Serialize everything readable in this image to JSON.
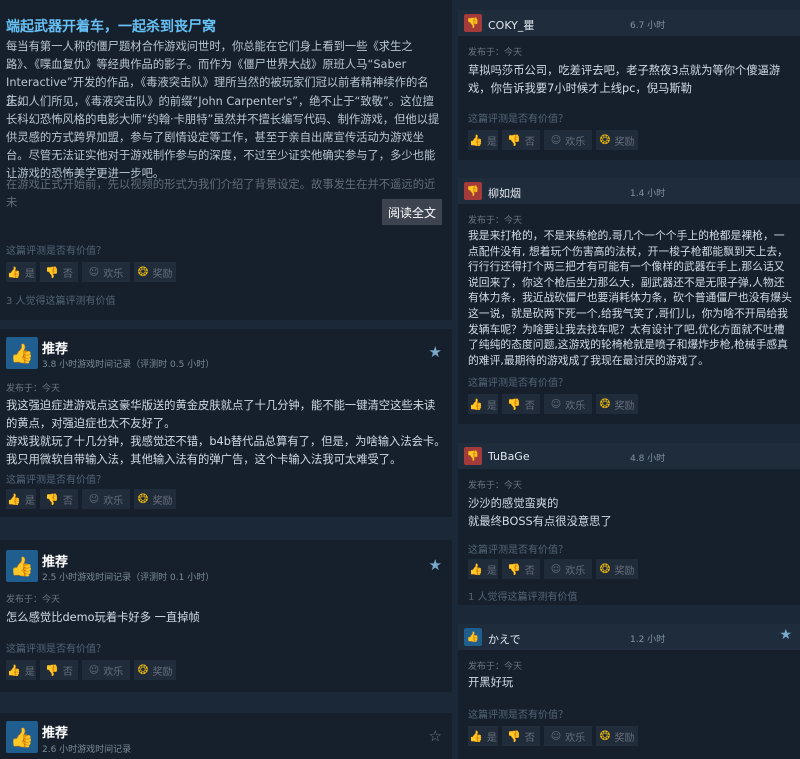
{
  "left": {
    "review1": {
      "title": "端起武器开着车，一起杀到丧尸窝",
      "paragraphs": [
        "每当有第一人称的僵尸题材合作游戏问世时，你总能在它们身上看到一些《求生之路》、《喋血复仇》等经典作品的影子。而作为《僵尸世界大战》原班人马“Saber Interactive”开发的作品，《毒液突击队》理所当然的被玩家们冠以前者精神续作的名头。",
        "正如人们所见，《毒液突击队》的前缀“John Carpenter's”，绝不止于“致敬”。这位擅长科幻恐怖风格的电影大师“约翰·卡朋特”虽然并不擅长编写代码、制作游戏，但他以提供灵感的方式跨界加盟，参与了剧情设定等工作，甚至于亲自出席宣传活动为游戏坐台。尽管无法证实他对于游戏制作参与的深度，不过至少证实他确实参与了，多少也能让游戏的恐怖美学更进一步吧。",
        "在游戏正式开始前，先以视频的形式为我们介绍了背景设定。故事发生在并不遥远的近未"
      ],
      "read_more": "阅读全文",
      "helpful_q": "这篇评测是否有价值？",
      "yes": "是",
      "no": "否",
      "funny": "欢乐",
      "award": "奖励",
      "helpful_count": "3 人觉得这篇评测有价值"
    },
    "review2": {
      "verdict": "推荐",
      "hours": "3.8 小时游戏时间记录（评测时 0.5 小时）",
      "posted": "发布于：今天",
      "text": "我这强迫症进游戏点这豪华版送的黄金皮肤就点了十几分钟，能不能一键清空这些未读的黄点，对强迫症也太不友好了。\n游戏我就玩了十几分钟，我感觉还不错，b4b替代品总算有了，但是，为啥输入法会卡。\n我只用微软自带输入法，其他输入法有的弹广告，这个卡输入法我可太难受了。",
      "helpful_q": "这篇评测是否有价值？",
      "yes": "是",
      "no": "否",
      "funny": "欢乐",
      "award": "奖励"
    },
    "review3": {
      "verdict": "推荐",
      "hours": "2.5 小时游戏时间记录（评测时 0.1 小时）",
      "posted": "发布于：今天",
      "text": "怎么感觉比demo玩着卡好多 一直掉帧",
      "helpful_q": "这篇评测是否有价值？",
      "yes": "是",
      "no": "否",
      "funny": "欢乐",
      "award": "奖励"
    },
    "review4": {
      "verdict": "推荐",
      "hours": "2.6 小时游戏时间记录"
    }
  },
  "right": {
    "r1": {
      "name": "COKY_瞿",
      "hours": "6.7 小时",
      "posted": "发布于：今天",
      "text": "草拟吗莎币公司，吃差评去吧，老子熬夜3点就为等你个傻逼游戏，你告诉我要7小时候才上线pc，倪马斯勒",
      "helpful_q": "这篇评测是否有价值？",
      "yes": "是",
      "no": "否",
      "funny": "欢乐",
      "award": "奖励"
    },
    "r2": {
      "name": "柳如烟",
      "hours": "1.4 小时",
      "posted": "发布于：今天",
      "text": "我是来打枪的，不是来练枪的,哥几个一个个手上的枪都是裸枪，一点配件没有, 想着玩个伤害高的法杖，开一梭子枪都能飘到天上去，行行行还得打个两三把才有可能有一个像样的武器在手上,那么话又说回来了，你这个枪后坐力那么大，副武器还不是无限子弹,人物还有体力条，我近战砍僵尸也要消耗体力条，砍个普通僵尸也没有爆头这一说，就是砍两下死一个,给我气笑了,哥们儿，你为啥不开局给我发辆车呢？为啥要让我去找车呢？太有设计了吧,优化方面就不吐槽了纯纯的态度问题,这游戏的轮椅枪就是喷子和爆炸步枪,枪械手感真的难评,最期待的游戏成了我现在最讨厌的游戏了。",
      "helpful_q": "这篇评测是否有价值？",
      "yes": "是",
      "no": "否",
      "funny": "欢乐",
      "award": "奖励"
    },
    "r3": {
      "name": "TuBaGe",
      "hours": "4.8 小时",
      "posted": "发布于：今天",
      "text": "沙沙的感觉蛮爽的\n就最终BOSS有点很没意思了",
      "helpful_q": "这篇评测是否有价值？",
      "yes": "是",
      "no": "否",
      "funny": "欢乐",
      "award": "奖励",
      "helpful_count": "1 人觉得这篇评测有价值"
    },
    "r4": {
      "name": "かえで",
      "hours": "1.2 小时",
      "posted": "发布于：今天",
      "text": "开黑好玩",
      "helpful_q": "这篇评测是否有价值？",
      "yes": "是",
      "no": "否",
      "funny": "欢乐",
      "award": "奖励"
    }
  },
  "icons": {
    "thumb_up": "thumb-up-icon",
    "thumb_down": "thumb-down-icon",
    "star": "star-icon",
    "award": "award-icon",
    "funny": "smile-icon"
  },
  "colors": {
    "background": "#1b2838",
    "card": "#16202d",
    "accent": "#66c0f4",
    "recommended": "#1f5e8f",
    "not_recommended": "#a33b3b"
  }
}
